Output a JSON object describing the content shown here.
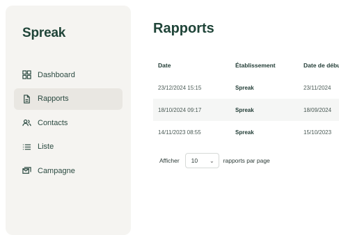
{
  "app": {
    "name": "Spreak"
  },
  "sidebar": {
    "items": [
      {
        "label": "Dashboard",
        "icon": "grid-icon",
        "active": false
      },
      {
        "label": "Rapports",
        "icon": "document-icon",
        "active": true
      },
      {
        "label": "Contacts",
        "icon": "users-icon",
        "active": false
      },
      {
        "label": "Liste",
        "icon": "list-icon",
        "active": false
      },
      {
        "label": "Campagne",
        "icon": "campaign-icon",
        "active": false
      }
    ]
  },
  "main": {
    "title": "Rapports",
    "table": {
      "headers": [
        "Date",
        "Établissement",
        "Date de débu"
      ],
      "rows": [
        {
          "date": "23/12/2024 15:15",
          "etablissement": "Spreak",
          "debut": "23/11/2024"
        },
        {
          "date": "18/10/2024 09:17",
          "etablissement": "Spreak",
          "debut": "18/09/2024"
        },
        {
          "date": "14/11/2023 08:55",
          "etablissement": "Spreak",
          "debut": "15/10/2023"
        }
      ]
    },
    "pagination": {
      "prefix": "Afficher",
      "page_size": "10",
      "suffix": "rapports par page"
    }
  },
  "colors": {
    "brand": "#1f4438",
    "sidebar_bg": "#f5f4f1",
    "active_bg": "#e9e7e2",
    "row_alt": "#f5f6f5"
  }
}
